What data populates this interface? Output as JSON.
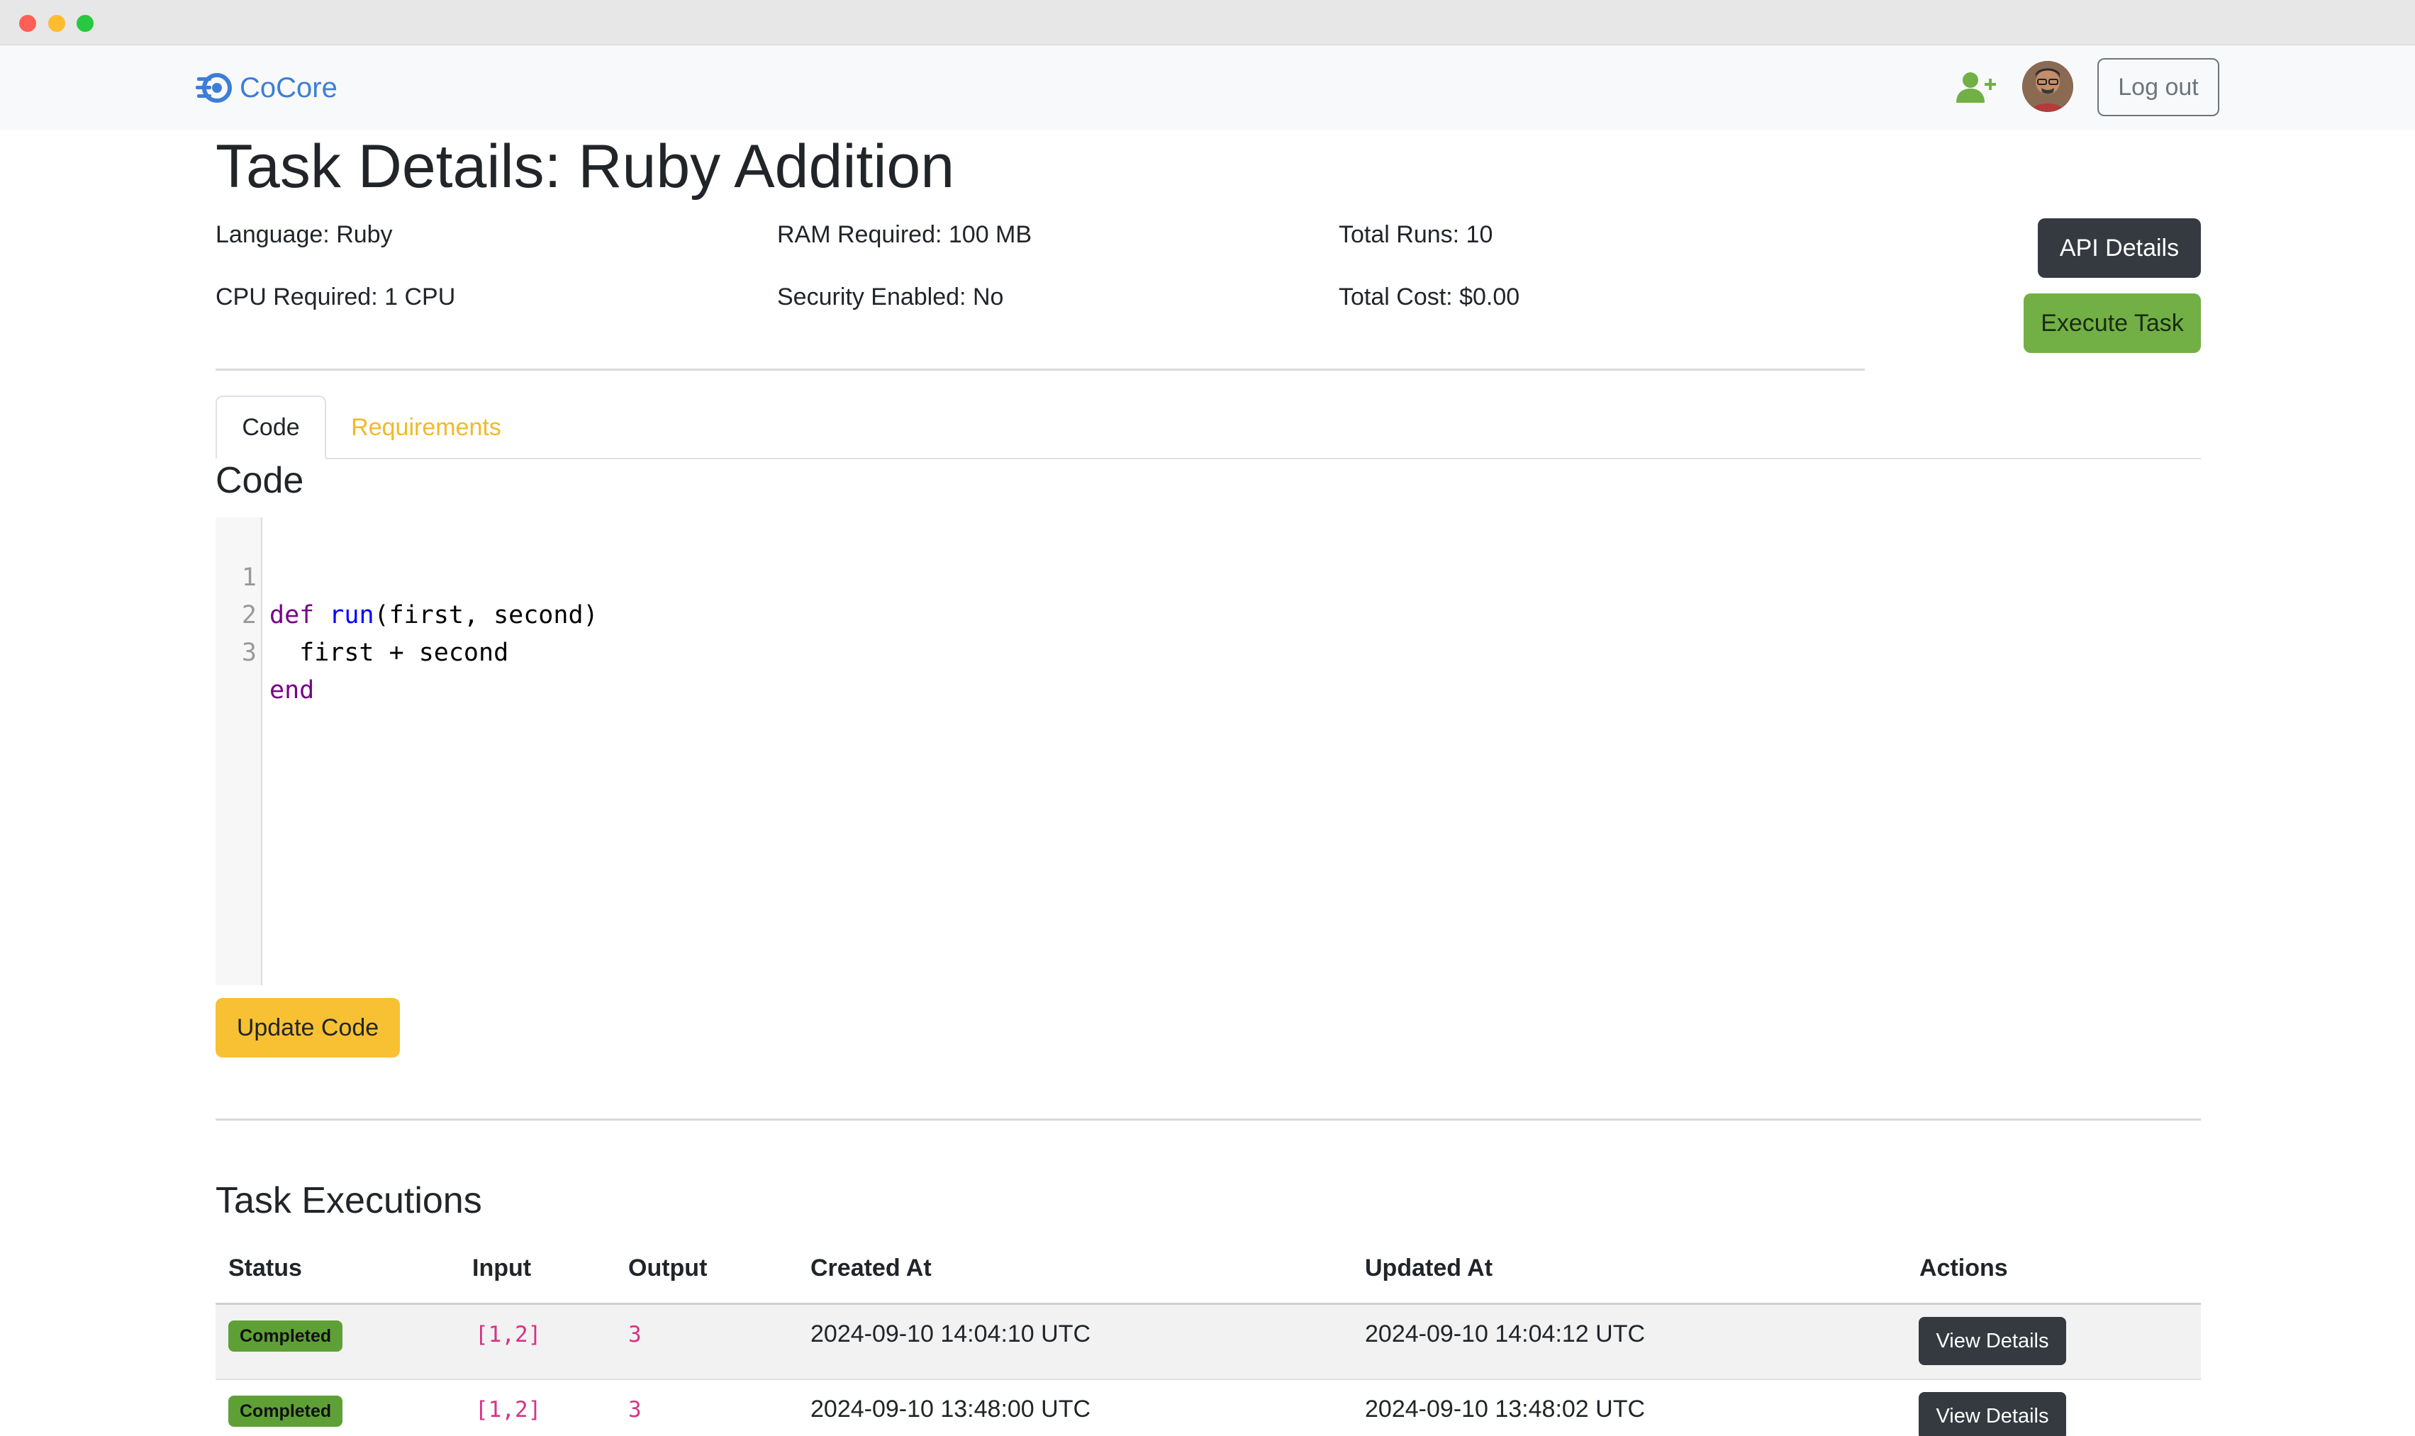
{
  "app": {
    "brand": "CoCore"
  },
  "nav": {
    "logout_label": "Log out",
    "add_user_icon": "user-plus-icon",
    "avatar": "user-avatar"
  },
  "page": {
    "title": "Task Details: Ruby Addition"
  },
  "info": {
    "language_label": "Language:",
    "language_value": "Ruby",
    "ram_label": "RAM Required:",
    "ram_value": "100 MB",
    "runs_label": "Total Runs:",
    "runs_value": "10",
    "cpu_label": "CPU Required:",
    "cpu_value": "1 CPU",
    "security_label": "Security Enabled:",
    "security_value": "No",
    "cost_label": "Total Cost:",
    "cost_value": "$0.00"
  },
  "actions": {
    "api_details": "API Details",
    "execute_task": "Execute Task"
  },
  "tabs": [
    {
      "label": "Code",
      "active": true
    },
    {
      "label": "Requirements",
      "active": false
    }
  ],
  "code_section": {
    "title": "Code",
    "line_numbers": [
      "1",
      "2",
      "3"
    ],
    "lines": [
      {
        "kw": "def",
        "fn": "run",
        "rest": "(first, second)"
      },
      {
        "text": "  first + second"
      },
      {
        "kw": "end"
      }
    ],
    "update_label": "Update Code"
  },
  "executions": {
    "title": "Task Executions",
    "columns": [
      "Status",
      "Input",
      "Output",
      "Created At",
      "Updated At",
      "Actions"
    ],
    "rows": [
      {
        "status": "Completed",
        "input": "[1,2]",
        "output": "3",
        "created": "2024-09-10 14:04:10 UTC",
        "updated": "2024-09-10 14:04:12 UTC",
        "action": "View Details"
      },
      {
        "status": "Completed",
        "input": "[1,2]",
        "output": "3",
        "created": "2024-09-10 13:48:00 UTC",
        "updated": "2024-09-10 13:48:02 UTC",
        "action": "View Details"
      }
    ]
  },
  "colors": {
    "brand": "#3d7fd6",
    "success": "#72b046",
    "warning": "#f8c133",
    "dark": "#343a40",
    "tab_link": "#f2b928",
    "code_pink": "#d63384"
  }
}
